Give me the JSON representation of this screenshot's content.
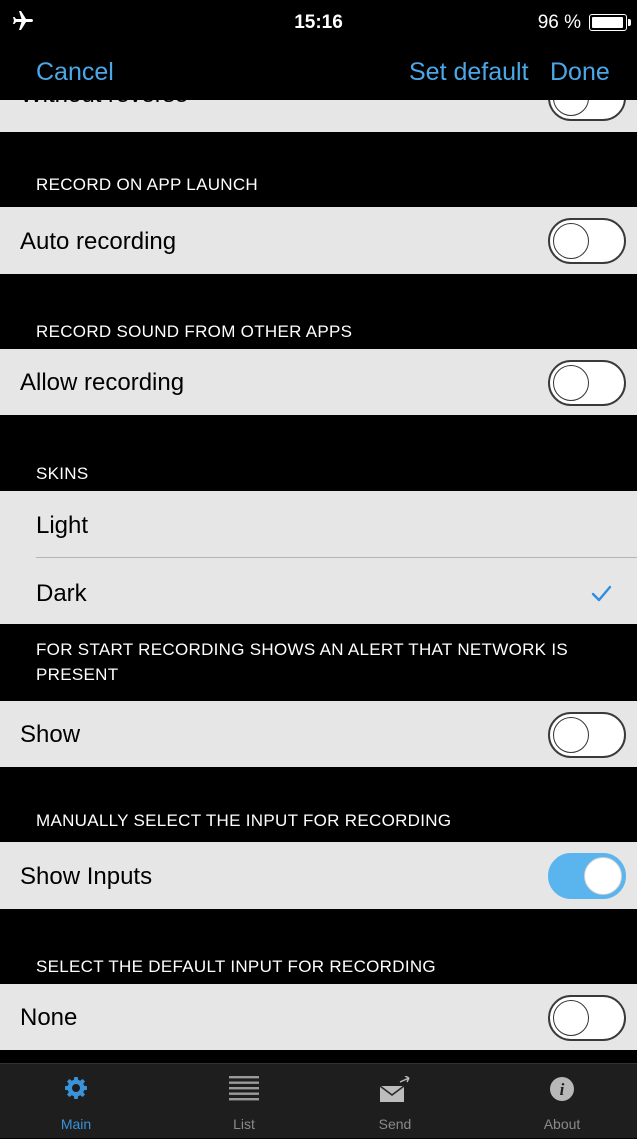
{
  "status": {
    "time": "15:16",
    "battery": "96 %",
    "battery_level": 0.96
  },
  "nav": {
    "cancel": "Cancel",
    "set_default": "Set default",
    "done": "Done"
  },
  "partial_row": {
    "label": "Without reverse",
    "toggle_on": false
  },
  "sections": {
    "record_launch": {
      "header": "RECORD ON APP LAUNCH",
      "row_label": "Auto recording",
      "toggle_on": false
    },
    "record_sound": {
      "header": "RECORD SOUND FROM OTHER APPS",
      "row_label": "Allow recording",
      "toggle_on": false
    },
    "skins": {
      "header": "SKINS",
      "options": [
        "Light",
        "Dark"
      ],
      "selected": "Dark"
    },
    "network_alert": {
      "header": "FOR START RECORDING SHOWS AN ALERT THAT NETWORK IS PRESENT",
      "row_label": "Show",
      "toggle_on": false
    },
    "manual_input": {
      "header": "MANUALLY SELECT THE INPUT FOR RECORDING",
      "row_label": "Show Inputs",
      "toggle_on": true
    },
    "default_input": {
      "header": "SELECT THE DEFAULT INPUT FOR RECORDING",
      "row_label": "None",
      "toggle_on": false
    }
  },
  "tabs": [
    {
      "label": "Main",
      "icon": "gear-icon",
      "active": true
    },
    {
      "label": "List",
      "icon": "list-icon",
      "active": false
    },
    {
      "label": "Send",
      "icon": "envelope-icon",
      "active": false
    },
    {
      "label": "About",
      "icon": "info-icon",
      "active": false
    }
  ],
  "colors": {
    "accent": "#4aa8e8",
    "toggle_on": "#5ab4ee",
    "row_bg": "#e6e6e6",
    "background": "#000000"
  }
}
